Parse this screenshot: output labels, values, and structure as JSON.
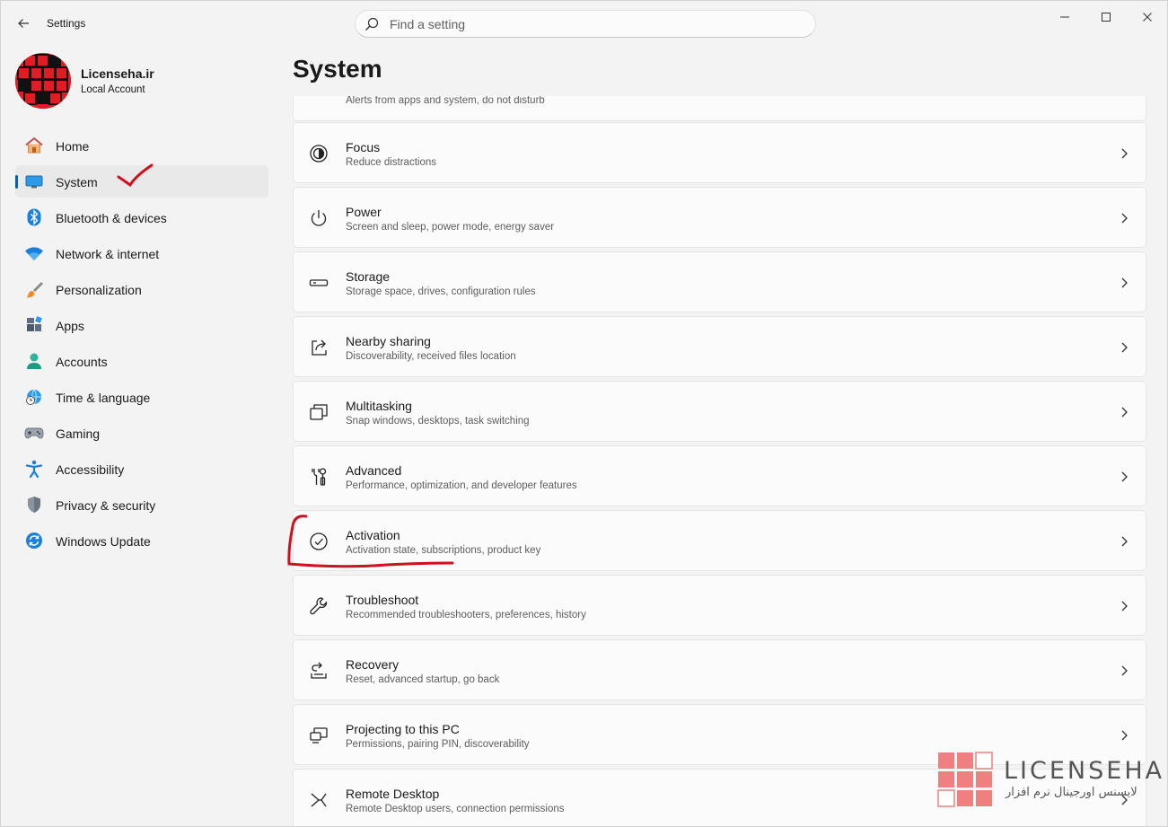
{
  "window": {
    "title": "Settings"
  },
  "search": {
    "placeholder": "Find a setting"
  },
  "profile": {
    "name": "Licenseha.ir",
    "account_type": "Local Account"
  },
  "sidebar": {
    "items": [
      {
        "label": "Home",
        "icon": "home-icon",
        "active": false
      },
      {
        "label": "System",
        "icon": "system-icon",
        "active": true
      },
      {
        "label": "Bluetooth & devices",
        "icon": "bluetooth-icon",
        "active": false
      },
      {
        "label": "Network & internet",
        "icon": "wifi-icon",
        "active": false
      },
      {
        "label": "Personalization",
        "icon": "brush-icon",
        "active": false
      },
      {
        "label": "Apps",
        "icon": "apps-icon",
        "active": false
      },
      {
        "label": "Accounts",
        "icon": "person-icon",
        "active": false
      },
      {
        "label": "Time & language",
        "icon": "globe-clock-icon",
        "active": false
      },
      {
        "label": "Gaming",
        "icon": "gamepad-icon",
        "active": false
      },
      {
        "label": "Accessibility",
        "icon": "accessibility-icon",
        "active": false
      },
      {
        "label": "Privacy & security",
        "icon": "shield-icon",
        "active": false
      },
      {
        "label": "Windows Update",
        "icon": "update-icon",
        "active": false
      }
    ]
  },
  "main": {
    "title": "System",
    "cards": [
      {
        "title": "",
        "subtitle": "Alerts from apps and system, do not disturb",
        "icon": "notifications-icon"
      },
      {
        "title": "Focus",
        "subtitle": "Reduce distractions",
        "icon": "focus-icon"
      },
      {
        "title": "Power",
        "subtitle": "Screen and sleep, power mode, energy saver",
        "icon": "power-icon"
      },
      {
        "title": "Storage",
        "subtitle": "Storage space, drives, configuration rules",
        "icon": "storage-icon"
      },
      {
        "title": "Nearby sharing",
        "subtitle": "Discoverability, received files location",
        "icon": "share-icon"
      },
      {
        "title": "Multitasking",
        "subtitle": "Snap windows, desktops, task switching",
        "icon": "multitasking-icon"
      },
      {
        "title": "Advanced",
        "subtitle": "Performance, optimization, and developer features",
        "icon": "tools-icon"
      },
      {
        "title": "Activation",
        "subtitle": "Activation state, subscriptions, product key",
        "icon": "check-circle-icon"
      },
      {
        "title": "Troubleshoot",
        "subtitle": "Recommended troubleshooters, preferences, history",
        "icon": "wrench-icon"
      },
      {
        "title": "Recovery",
        "subtitle": "Reset, advanced startup, go back",
        "icon": "recovery-icon"
      },
      {
        "title": "Projecting to this PC",
        "subtitle": "Permissions, pairing PIN, discoverability",
        "icon": "projecting-icon"
      },
      {
        "title": "Remote Desktop",
        "subtitle": "Remote Desktop users, connection permissions",
        "icon": "remote-desktop-icon"
      }
    ]
  },
  "watermark": {
    "brand": "LICENSEHA",
    "tagline": "لایسنس اورجینال نرم افزار"
  },
  "colors": {
    "accent": "#005fb8",
    "annotation": "#d0101c",
    "logo_red": "#e21c25"
  }
}
